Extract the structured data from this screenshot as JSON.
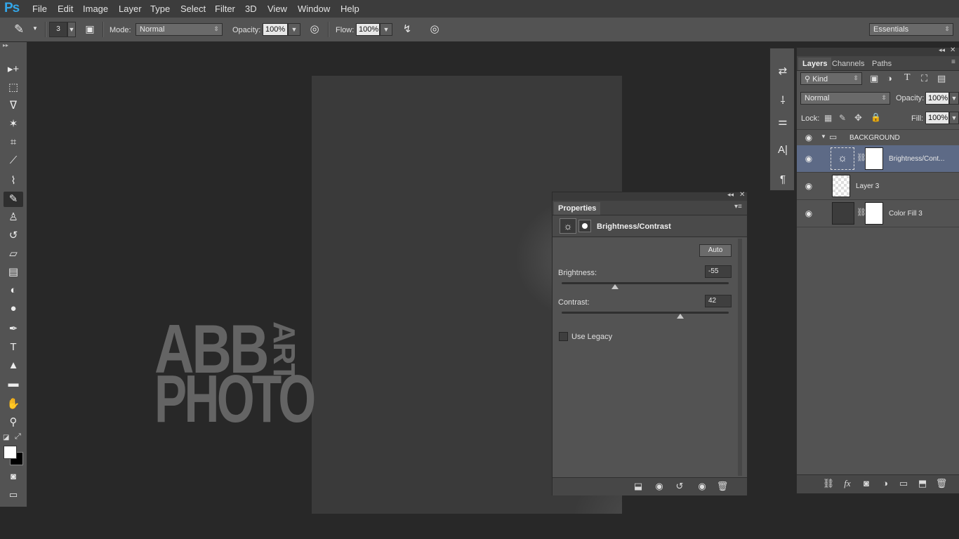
{
  "app": {
    "logo": "Ps"
  },
  "menu": [
    "File",
    "Edit",
    "Image",
    "Layer",
    "Type",
    "Select",
    "Filter",
    "3D",
    "View",
    "Window",
    "Help"
  ],
  "options_bar": {
    "brush_size": "3",
    "mode_label": "Mode:",
    "mode_value": "Normal",
    "opacity_label": "Opacity:",
    "opacity_value": "100%",
    "flow_label": "Flow:",
    "flow_value": "100%",
    "workspace": "Essentials"
  },
  "toolbox": {
    "tools": [
      {
        "name": "move-tool",
        "glyph": "▸+"
      },
      {
        "name": "marquee-tool",
        "glyph": "⬚"
      },
      {
        "name": "lasso-tool",
        "glyph": "ᐁ"
      },
      {
        "name": "magic-wand-tool",
        "glyph": "✶"
      },
      {
        "name": "crop-tool",
        "glyph": "⌗"
      },
      {
        "name": "eyedropper-tool",
        "glyph": "⟋"
      },
      {
        "name": "healing-brush-tool",
        "glyph": "⌇"
      },
      {
        "name": "brush-tool",
        "glyph": "✎"
      },
      {
        "name": "clone-stamp-tool",
        "glyph": "♙"
      },
      {
        "name": "history-brush-tool",
        "glyph": "↺"
      },
      {
        "name": "eraser-tool",
        "glyph": "▱"
      },
      {
        "name": "gradient-tool",
        "glyph": "▤"
      },
      {
        "name": "blur-tool",
        "glyph": "◐"
      },
      {
        "name": "dodge-tool",
        "glyph": "●"
      },
      {
        "name": "pen-tool",
        "glyph": "✒"
      },
      {
        "name": "type-tool",
        "glyph": "T"
      },
      {
        "name": "path-selection-tool",
        "glyph": "▲"
      },
      {
        "name": "rectangle-tool",
        "glyph": "▬"
      },
      {
        "name": "hand-tool",
        "glyph": "✋"
      },
      {
        "name": "zoom-tool",
        "glyph": "⚲"
      }
    ]
  },
  "watermark": {
    "line1": "ABB",
    "line2": "PHOTO",
    "vertical": "ART"
  },
  "properties": {
    "tab": "Properties",
    "title": "Brightness/Contrast",
    "auto_button": "Auto",
    "brightness_label": "Brightness:",
    "brightness_value": "-55",
    "brightness_fraction": 0.32,
    "contrast_label": "Contrast:",
    "contrast_value": "42",
    "contrast_fraction": 0.71,
    "use_legacy_label": "Use Legacy"
  },
  "layers_panel": {
    "tabs": [
      "Layers",
      "Channels",
      "Paths"
    ],
    "filter": "Kind",
    "blend_mode": "Normal",
    "opacity_label": "Opacity:",
    "opacity_value": "100%",
    "lock_label": "Lock:",
    "fill_label": "Fill:",
    "fill_value": "100%",
    "group_name": "BACKGROUND",
    "layers": [
      {
        "name": "Brightness/Cont...",
        "selected": true
      },
      {
        "name": "Layer 3",
        "selected": false
      },
      {
        "name": "Color Fill 3",
        "selected": false
      }
    ]
  },
  "colors": {
    "selection": "#5d6a86",
    "canvas_bg": "#282828",
    "panel": "#535353"
  }
}
